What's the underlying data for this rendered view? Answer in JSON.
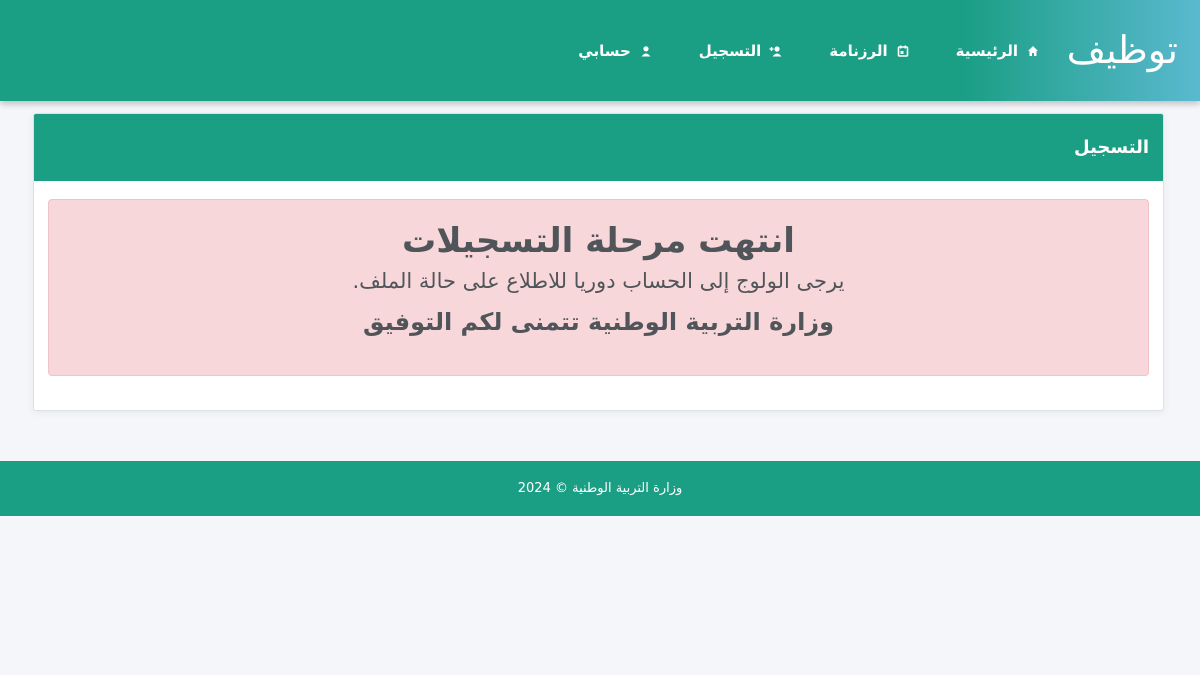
{
  "header": {
    "logo_text": "توظيف",
    "nav": [
      {
        "label": "الرئيسية",
        "icon": "home-icon"
      },
      {
        "label": "الرزنامة",
        "icon": "calendar-icon"
      },
      {
        "label": "التسجيل",
        "icon": "user-plus-icon"
      },
      {
        "label": "حسابي",
        "icon": "user-icon"
      }
    ]
  },
  "card": {
    "title": "التسجيل",
    "alert": {
      "title": "انتهت مرحلة التسجيلات",
      "line1": "يرجى الولوج إلى الحساب دوريا للاطلاع على حالة الملف.",
      "line2": "وزارة التربية الوطنية تتمنى لكم التوفيق"
    }
  },
  "footer": {
    "text": "وزارة التربية الوطنية © 2024"
  },
  "colors": {
    "primary": "#1a9e84",
    "gradient_end": "#5ab9cf",
    "alert_bg": "#f8d7da",
    "page_bg": "#f5f6fa"
  }
}
